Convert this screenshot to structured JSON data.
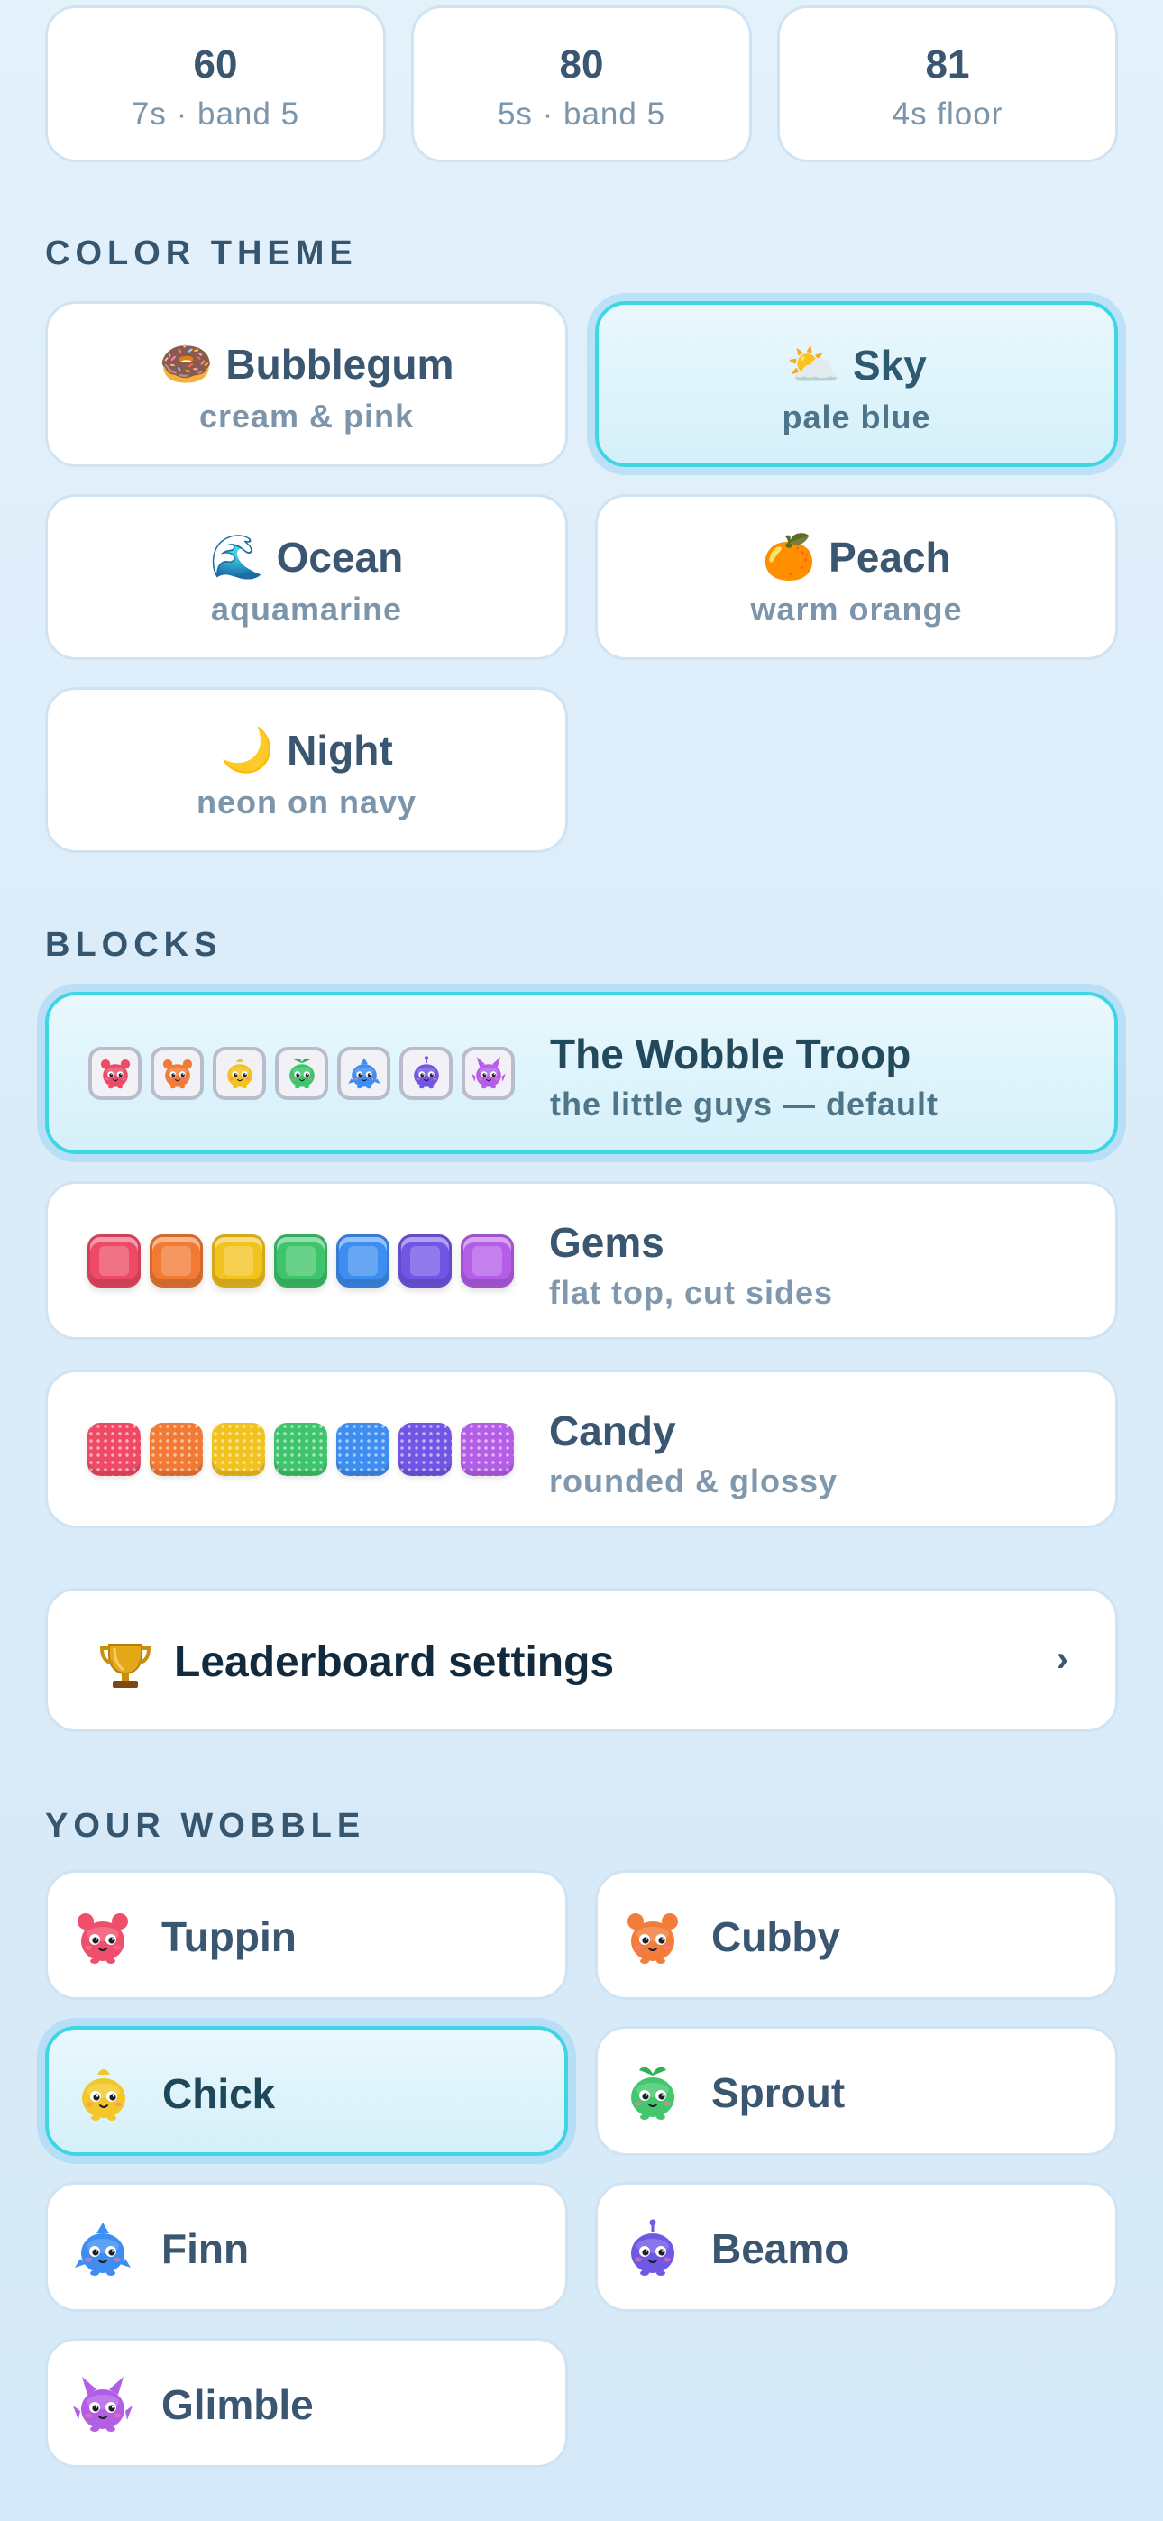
{
  "stats": [
    {
      "value": "60",
      "detail": "7s · band 5"
    },
    {
      "value": "80",
      "detail": "5s · band 5"
    },
    {
      "value": "81",
      "detail": "4s floor"
    }
  ],
  "color_theme": {
    "title": "COLOR THEME",
    "options": [
      {
        "emoji": "🍩",
        "name": "Bubblegum",
        "desc": "cream & pink",
        "selected": false
      },
      {
        "emoji": "⛅",
        "name": "Sky",
        "desc": "pale blue",
        "selected": true
      },
      {
        "emoji": "🌊",
        "name": "Ocean",
        "desc": "aquamarine",
        "selected": false
      },
      {
        "emoji": "🍊",
        "name": "Peach",
        "desc": "warm orange",
        "selected": false
      },
      {
        "emoji": "🌙",
        "name": "Night",
        "desc": "neon on navy",
        "selected": false
      }
    ]
  },
  "blocks": {
    "title": "BLOCKS",
    "options": [
      {
        "name": "The Wobble Troop",
        "desc": "the little guys — default",
        "selected": true
      },
      {
        "name": "Gems",
        "desc": "flat top, cut sides",
        "selected": false
      },
      {
        "name": "Candy",
        "desc": "rounded & glossy",
        "selected": false
      }
    ],
    "palette": [
      "#ee4a66",
      "#f27a34",
      "#f2c21e",
      "#3ec46a",
      "#3d8ef0",
      "#7355e6",
      "#b45ee8"
    ]
  },
  "leaderboard": {
    "label": "Leaderboard settings",
    "icon": "trophy-icon",
    "chevron": "›"
  },
  "your_wobble": {
    "title": "YOUR WOBBLE",
    "characters": [
      {
        "name": "Tuppin",
        "color": "#ef4f6c",
        "selected": false
      },
      {
        "name": "Cubby",
        "color": "#f27d3a",
        "selected": false
      },
      {
        "name": "Chick",
        "color": "#f3c72a",
        "selected": true
      },
      {
        "name": "Sprout",
        "color": "#43c76c",
        "selected": false
      },
      {
        "name": "Finn",
        "color": "#3d8ef0",
        "selected": false
      },
      {
        "name": "Beamo",
        "color": "#6f58e4",
        "selected": false
      },
      {
        "name": "Glimble",
        "color": "#b25fe6",
        "selected": false
      }
    ]
  },
  "colors": {
    "accent": "#3fd6e3",
    "text": "#3a5670",
    "muted": "#7c95ab",
    "border": "#cfe3f3"
  }
}
